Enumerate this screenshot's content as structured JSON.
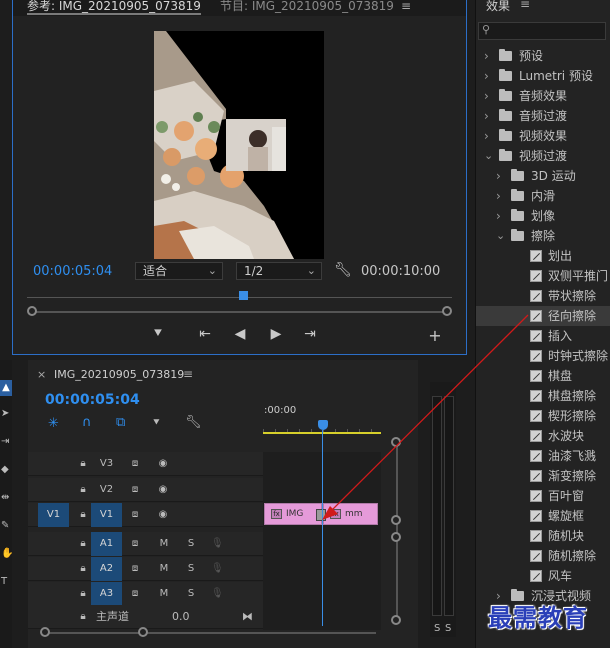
{
  "monitor": {
    "tab_source": "参考: IMG_20210905_073819",
    "tab_program": "节目: IMG_20210905_073819",
    "menu_icon": "≡",
    "current_time": "00:00:05:04",
    "fit_label": "适合",
    "resolution_label": "1/2",
    "duration": "00:00:10:00"
  },
  "effects": {
    "title": "效果",
    "menu_icon": "≡",
    "items": [
      {
        "label": "预设",
        "type": "folder-star",
        "level": 0,
        "open": false
      },
      {
        "label": "Lumetri 预设",
        "type": "folder-star",
        "level": 0,
        "open": false
      },
      {
        "label": "音频效果",
        "type": "folder",
        "level": 0,
        "open": false
      },
      {
        "label": "音频过渡",
        "type": "folder",
        "level": 0,
        "open": false
      },
      {
        "label": "视频效果",
        "type": "folder",
        "level": 0,
        "open": false
      },
      {
        "label": "视频过渡",
        "type": "folder",
        "level": 0,
        "open": true
      },
      {
        "label": "3D 运动",
        "type": "folder",
        "level": 1,
        "open": false
      },
      {
        "label": "内滑",
        "type": "folder",
        "level": 1,
        "open": false
      },
      {
        "label": "划像",
        "type": "folder",
        "level": 1,
        "open": false
      },
      {
        "label": "擦除",
        "type": "folder",
        "level": 1,
        "open": true
      },
      {
        "label": "划出",
        "type": "effect",
        "level": 2
      },
      {
        "label": "双侧平推门",
        "type": "effect",
        "level": 2
      },
      {
        "label": "带状擦除",
        "type": "effect",
        "level": 2
      },
      {
        "label": "径向擦除",
        "type": "effect",
        "level": 2,
        "selected": true
      },
      {
        "label": "插入",
        "type": "effect",
        "level": 2
      },
      {
        "label": "时钟式擦除",
        "type": "effect",
        "level": 2
      },
      {
        "label": "棋盘",
        "type": "effect",
        "level": 2
      },
      {
        "label": "棋盘擦除",
        "type": "effect",
        "level": 2
      },
      {
        "label": "楔形擦除",
        "type": "effect",
        "level": 2
      },
      {
        "label": "水波块",
        "type": "effect",
        "level": 2
      },
      {
        "label": "油漆飞溅",
        "type": "effect",
        "level": 2
      },
      {
        "label": "渐变擦除",
        "type": "effect",
        "level": 2
      },
      {
        "label": "百叶窗",
        "type": "effect",
        "level": 2
      },
      {
        "label": "螺旋框",
        "type": "effect",
        "level": 2
      },
      {
        "label": "随机块",
        "type": "effect",
        "level": 2
      },
      {
        "label": "随机擦除",
        "type": "effect",
        "level": 2
      },
      {
        "label": "风车",
        "type": "effect",
        "level": 2
      },
      {
        "label": "沉浸式视频",
        "type": "folder",
        "level": 1,
        "open": false
      }
    ]
  },
  "timeline": {
    "sequence_name": "IMG_20210905_073819",
    "close_icon": "×",
    "menu_icon": "≡",
    "current_time": "00:00:05:04",
    "ruler_start": ":00:00",
    "tracks": [
      {
        "name": "V3",
        "mute": "",
        "solo": ""
      },
      {
        "name": "V2",
        "mute": "",
        "solo": ""
      },
      {
        "name": "V1",
        "mute": "",
        "solo": ""
      },
      {
        "name": "A1",
        "mute": "M",
        "solo": "S"
      },
      {
        "name": "A2",
        "mute": "M",
        "solo": "S"
      },
      {
        "name": "A3",
        "mute": "M",
        "solo": "S"
      }
    ],
    "source_patch_v": "V1",
    "master_label": "主声道",
    "master_value": "0.0",
    "clip_a_label": "IMG",
    "clip_b_label": "mm",
    "fx_badge": "fx"
  },
  "meter": {
    "solo_left": "S",
    "solo_right": "S"
  },
  "watermark": {
    "text": "最需教育"
  },
  "colors": {
    "accent": "#2f8ff0",
    "clip": "#e59ad9",
    "playhead": "#3a8ee6",
    "arrow": "#d11a1a"
  }
}
